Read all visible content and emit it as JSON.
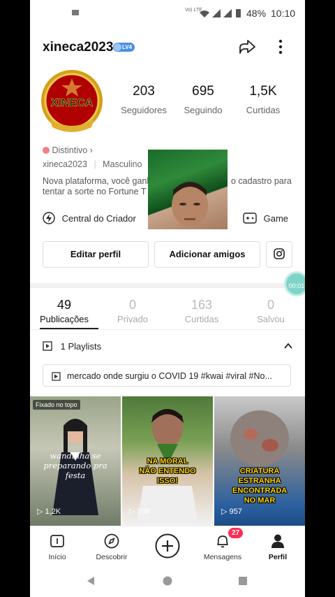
{
  "status_bar": {
    "signal_text": "Vo) LTE",
    "battery": "48%",
    "time": "10:10"
  },
  "profile": {
    "username": "xineca2023",
    "level": "LV4",
    "avatar_text": "XINECA",
    "stats": [
      {
        "value": "203",
        "label": "Seguidores"
      },
      {
        "value": "695",
        "label": "Seguindo"
      },
      {
        "value": "1,5K",
        "label": "Curtidas"
      }
    ],
    "badge_label": "Distintivo",
    "meta_id": "xineca2023",
    "meta_gender": "Masculino",
    "bio_line1": "Nova plataforma, você ganha",
    "bio_line1_end": "o cadastro para",
    "bio_line2": "tentar a sorte no Fortune T"
  },
  "tools": {
    "creator_center": "Central do Criador",
    "game": "Game"
  },
  "buttons": {
    "edit_profile": "Editar perfil",
    "add_friends": "Adicionar amigos"
  },
  "floating_timer": "00:01",
  "tabs": [
    {
      "count": "49",
      "label": "Publicações",
      "active": true
    },
    {
      "count": "0",
      "label": "Privado",
      "active": false
    },
    {
      "count": "163",
      "label": "Curtidas",
      "active": false
    },
    {
      "count": "0",
      "label": "Salvou",
      "active": false
    }
  ],
  "playlists": {
    "title": "1 Playlists",
    "item": "mercado onde surgiu o COVID 19 #kwai #viral #No..."
  },
  "videos": [
    {
      "pinned": "Fixado no topo",
      "caption": "wandinha se preparando pra festa",
      "views": "1,2K"
    },
    {
      "caption": "NA MORAL NÃO ENTENDO ISSO!",
      "views": "598"
    },
    {
      "caption": "CRIATURA ESTRANHA ENCONTRADA NO MAR",
      "views": "957"
    }
  ],
  "bottom_nav": [
    {
      "label": "Início",
      "icon": "home-icon"
    },
    {
      "label": "Descobrir",
      "icon": "compass-icon"
    },
    {
      "label": "",
      "icon": "plus-icon"
    },
    {
      "label": "Mensagens",
      "icon": "bell-icon",
      "badge": "27"
    },
    {
      "label": "Perfil",
      "icon": "person-icon",
      "active": true
    }
  ],
  "colors": {
    "accent_teal": "#7fd4c8",
    "level_blue": "#4a90e2",
    "badge_red": "#ff2d55"
  }
}
